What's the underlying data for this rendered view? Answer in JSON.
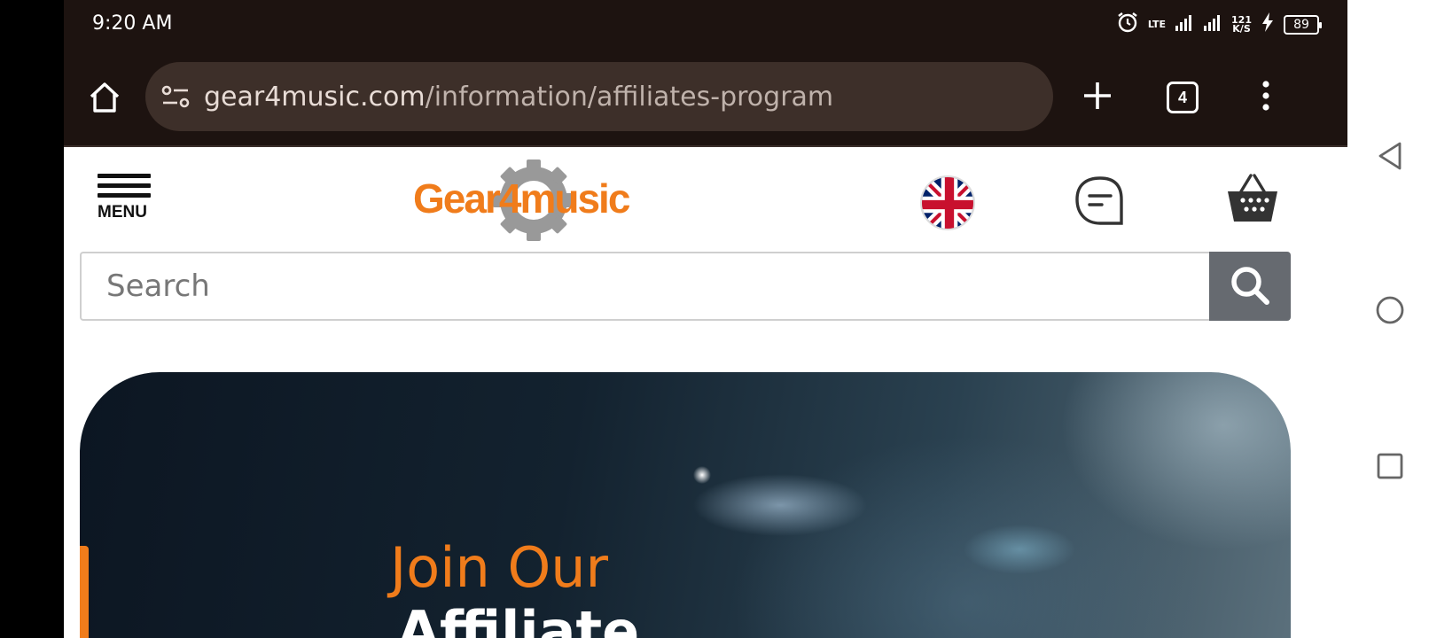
{
  "status_bar": {
    "time": "9:20 AM",
    "lte_label": "LTE",
    "net_speed_value": "121",
    "net_speed_unit": "K/S",
    "battery_level": "89"
  },
  "browser": {
    "url_host": "gear4music.com",
    "url_path": "/information/affiliates-program",
    "tab_count": "4"
  },
  "site_header": {
    "menu_label": "MENU",
    "logo_text_part1": "Gear",
    "logo_text_digit": "4",
    "logo_text_part2": "music"
  },
  "search": {
    "placeholder": "Search"
  },
  "hero": {
    "heading": "Join Our",
    "subheading": "Affiliate"
  },
  "colors": {
    "brand_orange": "#f07c1b",
    "toolbar_bg": "#1d1310",
    "url_bar_bg": "#3d2f29",
    "search_button_bg": "#666a70",
    "hero_dark": "#0c1622"
  },
  "icons": {
    "home": "home-icon",
    "site_settings": "site-settings-icon",
    "new_tab": "plus-icon",
    "tabs": "tab-switcher-icon",
    "more": "more-vert-icon",
    "flag": "uk-flag-icon",
    "chat": "chat-icon",
    "basket": "basket-icon",
    "search": "search-icon",
    "back": "back-triangle-icon",
    "home_nav": "home-circle-icon",
    "recents": "recents-square-icon"
  }
}
